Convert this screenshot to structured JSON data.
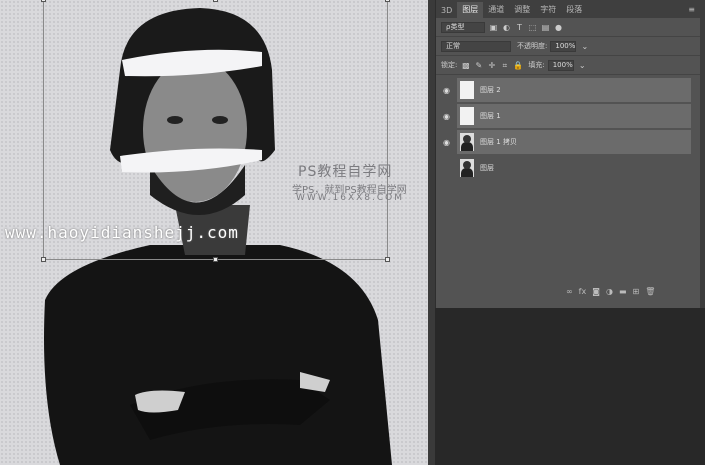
{
  "canvas": {
    "watermark_site_title": "PS教程自学网",
    "watermark_slogan": "学PS，就到PS教程自学网",
    "watermark_url": "WWW.16XX8.COM",
    "watermark_overlay": "www.haoyidianshejj.com"
  },
  "panel": {
    "tabs": [
      "3D",
      "图层",
      "通道",
      "调整",
      "字符",
      "段落"
    ],
    "active_tab": "图层",
    "filter_label": "ρ类型",
    "blend_mode": "正常",
    "opacity_label": "不透明度:",
    "opacity_value": "100%",
    "lock_label": "锁定:",
    "fill_label": "填充:",
    "fill_value": "100%",
    "layers": [
      {
        "name": "图层 2",
        "visible": true,
        "selected": true
      },
      {
        "name": "图层 1",
        "visible": true,
        "selected": true
      },
      {
        "name": "图层 1 拷贝",
        "visible": true,
        "selected": true
      },
      {
        "name": "图层",
        "visible": false,
        "selected": false
      }
    ],
    "footer_icons": [
      "link-icon",
      "fx-icon",
      "mask-icon",
      "adjustment-icon",
      "folder-icon",
      "new-layer-icon",
      "trash-icon"
    ]
  }
}
